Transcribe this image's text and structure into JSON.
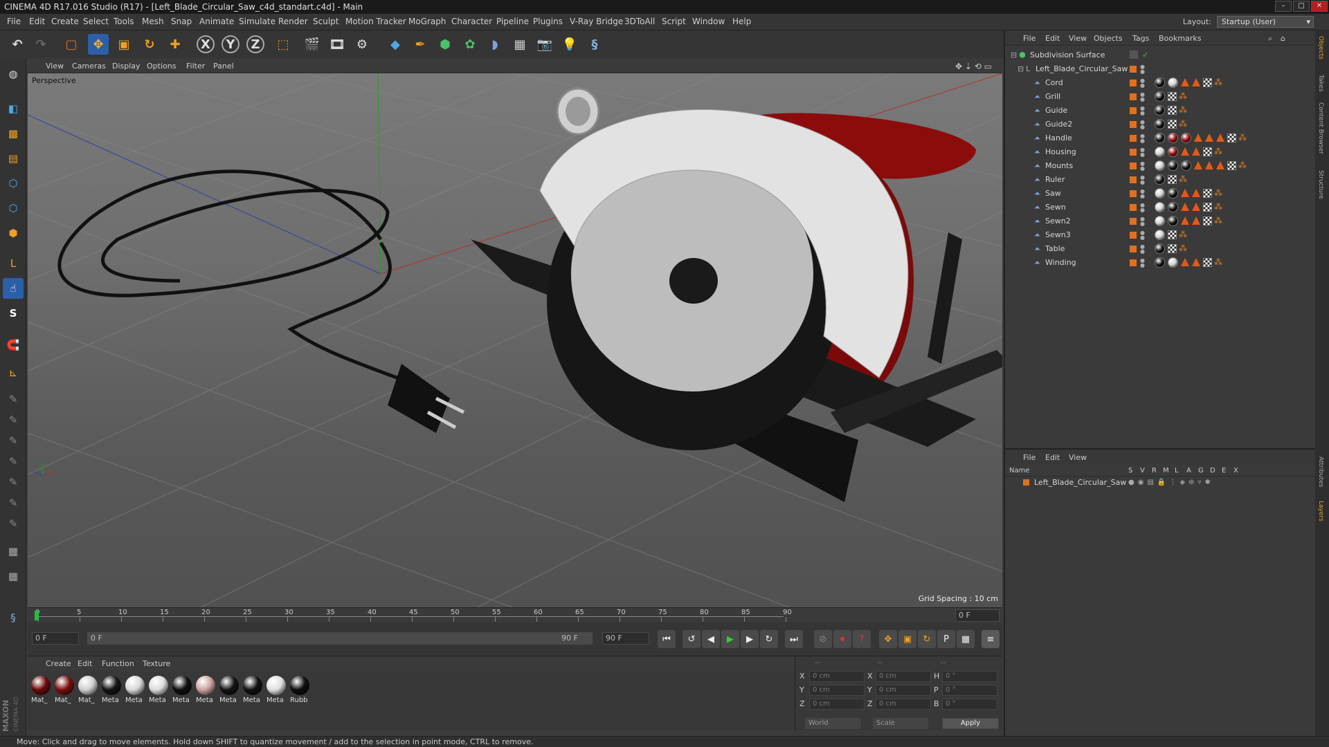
{
  "window": {
    "title": "CINEMA 4D R17.016 Studio (R17) - [Left_Blade_Circular_Saw_c4d_standart.c4d] - Main"
  },
  "menu": [
    "File",
    "Edit",
    "Create",
    "Select",
    "Tools",
    "Mesh",
    "Snap",
    "Animate",
    "Simulate",
    "Render",
    "Sculpt",
    "Motion Tracker",
    "MoGraph",
    "Character",
    "Pipeline",
    "Plugins",
    "V-Ray Bridge",
    "3DToAll",
    "Script",
    "Window",
    "Help"
  ],
  "layout": {
    "label": "Layout:",
    "value": "Startup (User)"
  },
  "viewport": {
    "menu": [
      "View",
      "Cameras",
      "Display",
      "Options",
      "Filter",
      "Panel"
    ],
    "label": "Perspective",
    "grid_spacing": "Grid Spacing : 10 cm"
  },
  "timeline": {
    "ticks": [
      "0",
      "5",
      "10",
      "15",
      "20",
      "25",
      "30",
      "35",
      "40",
      "45",
      "50",
      "55",
      "60",
      "65",
      "70",
      "75",
      "80",
      "85",
      "90"
    ],
    "end_field": "0 F",
    "current_frame": "0 F",
    "range_start": "0 F",
    "range_end": "90 F",
    "max_frame": "90 F"
  },
  "materials": {
    "menu": [
      "Create",
      "Edit",
      "Function",
      "Texture"
    ],
    "items": [
      {
        "label": "Mat_",
        "color": "#6a0b0b"
      },
      {
        "label": "Mat_",
        "color": "#7a0e0e"
      },
      {
        "label": "Mat_",
        "color": "#cfcfcf"
      },
      {
        "label": "Meta",
        "color": "#151515"
      },
      {
        "label": "Meta",
        "color": "#d8d8d8"
      },
      {
        "label": "Meta",
        "color": "#dcdcdc"
      },
      {
        "label": "Meta",
        "color": "#101010"
      },
      {
        "label": "Meta",
        "color": "#c9a3a3"
      },
      {
        "label": "Meta",
        "color": "#141414"
      },
      {
        "label": "Meta",
        "color": "#121212"
      },
      {
        "label": "Meta",
        "color": "#e0e0e0"
      },
      {
        "label": "Rubb",
        "color": "#0e0e0e"
      }
    ]
  },
  "coords": {
    "header": [
      "--",
      "--",
      "--"
    ],
    "rows": [
      {
        "a": "X",
        "av": "0 cm",
        "b": "X",
        "bv": "0 cm",
        "c": "H",
        "cv": "0 °"
      },
      {
        "a": "Y",
        "av": "0 cm",
        "b": "Y",
        "bv": "0 cm",
        "c": "P",
        "cv": "0 °"
      },
      {
        "a": "Z",
        "av": "0 cm",
        "b": "Z",
        "bv": "0 cm",
        "c": "B",
        "cv": "0 °"
      }
    ],
    "world": "World",
    "scale": "Scale",
    "apply": "Apply"
  },
  "objects": {
    "menu": [
      "File",
      "Edit",
      "View",
      "Objects",
      "Tags",
      "Bookmarks"
    ],
    "root": "Subdivision Surface",
    "group": "Left_Blade_Circular_Saw",
    "children": [
      "Cord",
      "Grill",
      "Guide",
      "Guide2",
      "Handle",
      "Housing",
      "Mounts",
      "Ruler",
      "Saw",
      "Sewn",
      "Sewn2",
      "Sewn3",
      "Table",
      "Winding"
    ]
  },
  "layers": {
    "menu": [
      "File",
      "Edit",
      "View"
    ],
    "columns": [
      "Name",
      "S",
      "V",
      "R",
      "M",
      "L",
      "A",
      "G",
      "D",
      "E",
      "X"
    ],
    "row": "Left_Blade_Circular_Saw"
  },
  "right_tabs": [
    "Objects",
    "Takes",
    "Content Browser",
    "Structure",
    "Attributes",
    "Layers"
  ],
  "status": "Move: Click and drag to move elements. Hold down SHIFT to quantize movement / add to the selection in point mode, CTRL to remove.",
  "logo": "MAXON CINEMA 4D",
  "colors": {
    "accent": "#e07020",
    "handle_red": "#8c0c0c"
  }
}
